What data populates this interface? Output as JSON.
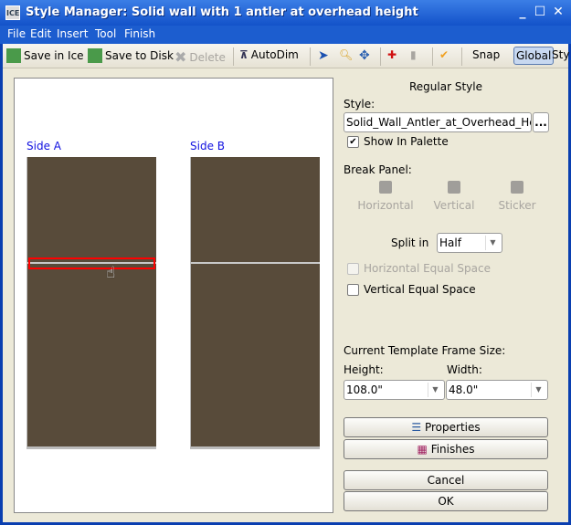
{
  "window": {
    "title": "Style Manager: Solid wall with 1 antler at overhead height",
    "icon_text": "ICE"
  },
  "menu": [
    "File",
    "Edit",
    "Insert",
    "Tool",
    "Finish"
  ],
  "toolbar": {
    "save_ice": "Save in Ice",
    "save_disk": "Save to Disk",
    "delete": "Delete",
    "autodim": "AutoDim",
    "snap": "Snap",
    "global": "Global",
    "style": "Sty"
  },
  "canvas": {
    "side_a": "Side A",
    "side_b": "Side B",
    "wall_color": "#584b3a",
    "selection_color": "#ff0000"
  },
  "panel": {
    "heading": "Regular Style",
    "style_label": "Style:",
    "style_value": "Solid_Wall_Antler_at_Overhead_Height",
    "browse": "...",
    "show_in_palette": "Show In Palette",
    "show_in_palette_checked": true,
    "break_panel": "Break Panel:",
    "break_options": [
      "Horizontal",
      "Vertical",
      "Sticker"
    ],
    "split_label": "Split in",
    "split_value": "Half",
    "horizontal_equal": "Horizontal Equal Space",
    "horizontal_equal_checked": false,
    "vertical_equal": "Vertical Equal Space",
    "vertical_equal_checked": false,
    "frame_size_label": "Current Template Frame Size:",
    "height_label": "Height:",
    "height_value": "108.0\"",
    "width_label": "Width:",
    "width_value": "48.0\"",
    "properties": "Properties",
    "finishes": "Finishes",
    "cancel": "Cancel",
    "ok": "OK"
  }
}
